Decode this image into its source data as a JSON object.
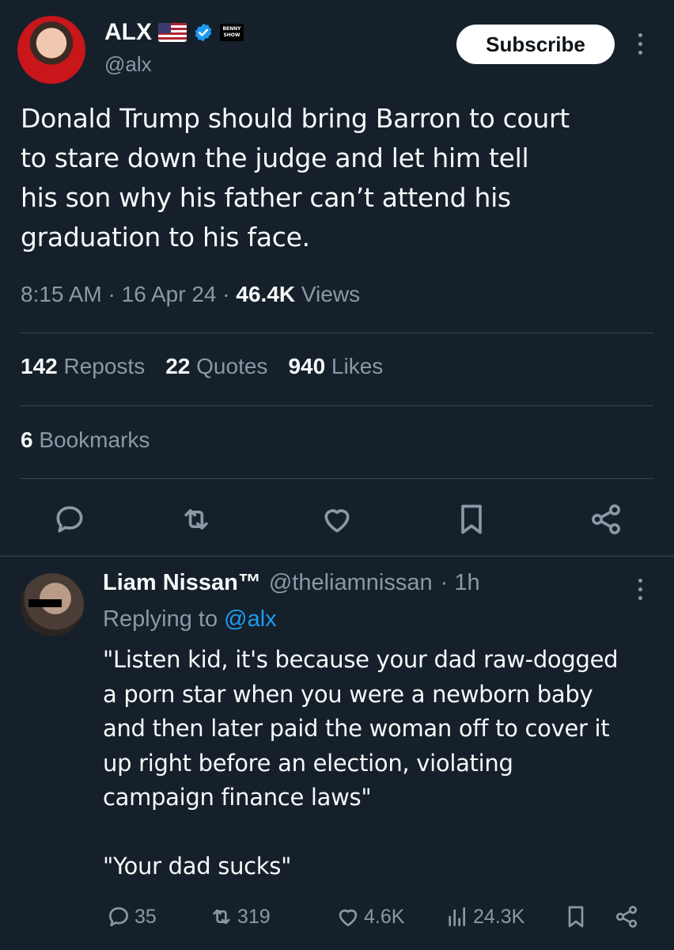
{
  "post": {
    "author": {
      "name": "ALX",
      "handle": "@alx",
      "badge_text": "BENNY SHOW"
    },
    "subscribe_label": "Subscribe",
    "text": "Donald Trump should bring Barron to court\nto stare down the judge and let him tell\nhis son why his father can’t attend his\ngraduation to his face.",
    "meta": {
      "time": "8:15 AM",
      "sep1": " · ",
      "date": "16 Apr 24",
      "sep2": " · ",
      "views_count": "46.4K",
      "views_label": " Views"
    },
    "stats": {
      "reposts_count": "142",
      "reposts_label": " Reposts",
      "quotes_count": "22",
      "quotes_label": " Quotes",
      "likes_count": "940",
      "likes_label": " Likes",
      "bookmarks_count": "6",
      "bookmarks_label": " Bookmarks"
    }
  },
  "reply": {
    "author": {
      "name": "Liam Nissan™",
      "handle": "@theliamnissan",
      "time": "· 1h"
    },
    "replying_prefix": "Replying to ",
    "replying_handle": "@alx",
    "text": "\"Listen kid, it's because your dad raw-dogged\na porn star when you were a newborn baby\nand then later paid the woman off to cover it\nup right before an election, violating\ncampaign finance laws\"\n\n\"Your dad sucks\"",
    "actions": {
      "replies": "35",
      "reposts": "319",
      "likes": "4.6K",
      "views": "24.3K"
    }
  },
  "colors": {
    "background": "#15202b",
    "text": "#f7f9f9",
    "secondary": "#8b98a5",
    "accent": "#1d9bf0",
    "divider": "#38444d"
  },
  "icons": {
    "reply": "speech-bubble-icon",
    "repost": "repost-arrows-icon",
    "like": "heart-icon",
    "bookmark": "bookmark-icon",
    "share": "share-icon",
    "views": "bar-chart-icon",
    "more": "more-vertical-icon",
    "verified": "verified-badge-icon",
    "flag": "us-flag-icon"
  }
}
